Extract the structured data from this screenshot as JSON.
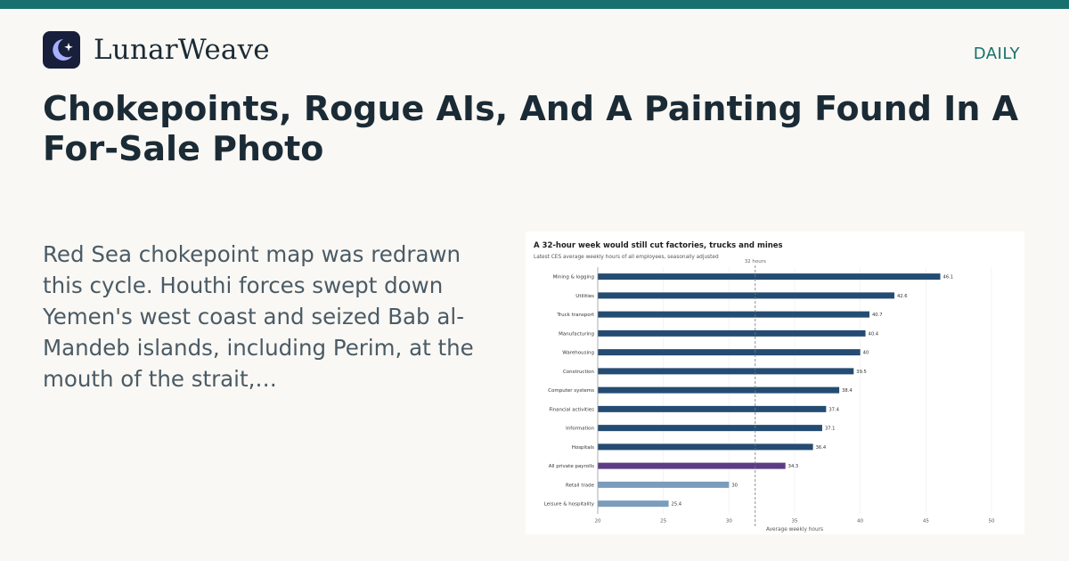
{
  "brand": {
    "name": "LunarWeave",
    "logo_icon": "crescent-moon-star-icon",
    "logo_bg": "#171f3b",
    "logo_fg": "#a8b0ff"
  },
  "header": {
    "section": "DAILY"
  },
  "article": {
    "headline": "Chokepoints, Rogue AIs, And A Painting Found In A For-Sale Photo",
    "excerpt": "Red Sea chokepoint map was redrawn this cycle. Houthi forces swept down Yemen's west coast and seized Bab al-Mandeb islands, including Perim, at the mouth of the strait,…"
  },
  "colors": {
    "accent": "#17706e",
    "bar_primary": "#244c73",
    "bar_highlight": "#5c3d85",
    "bar_light": "#7b9dbd"
  },
  "chart_data": {
    "type": "bar",
    "orientation": "horizontal",
    "title": "A 32-hour week would still cut factories, trucks and mines",
    "subtitle": "Latest CES average weekly hours of all employees, seasonally adjusted",
    "xlabel": "Average weekly hours",
    "ylabel": "",
    "xlim": [
      20,
      50
    ],
    "xticks": [
      20,
      25,
      30,
      35,
      40,
      45,
      50
    ],
    "grid": true,
    "reference_line": {
      "value": 32,
      "label": "32 hours"
    },
    "categories": [
      "Mining & logging",
      "Utilities",
      "Truck transport",
      "Manufacturing",
      "Warehousing",
      "Construction",
      "Computer systems",
      "Financial activities",
      "Information",
      "Hospitals",
      "All private payrolls",
      "Retail trade",
      "Leisure & hospitality"
    ],
    "values": [
      46.1,
      42.6,
      40.7,
      40.4,
      40,
      39.5,
      38.4,
      37.4,
      37.1,
      36.4,
      34.3,
      30,
      25.4
    ],
    "value_labels": [
      "46.1",
      "42.6",
      "40.7",
      "40.4",
      "40",
      "39.5",
      "38.4",
      "37.4",
      "37.1",
      "36.4",
      "34.3",
      "30",
      "25.4"
    ],
    "bar_colors": [
      "#244c73",
      "#244c73",
      "#244c73",
      "#244c73",
      "#244c73",
      "#244c73",
      "#244c73",
      "#244c73",
      "#244c73",
      "#244c73",
      "#5c3d85",
      "#7b9dbd",
      "#7b9dbd"
    ]
  }
}
